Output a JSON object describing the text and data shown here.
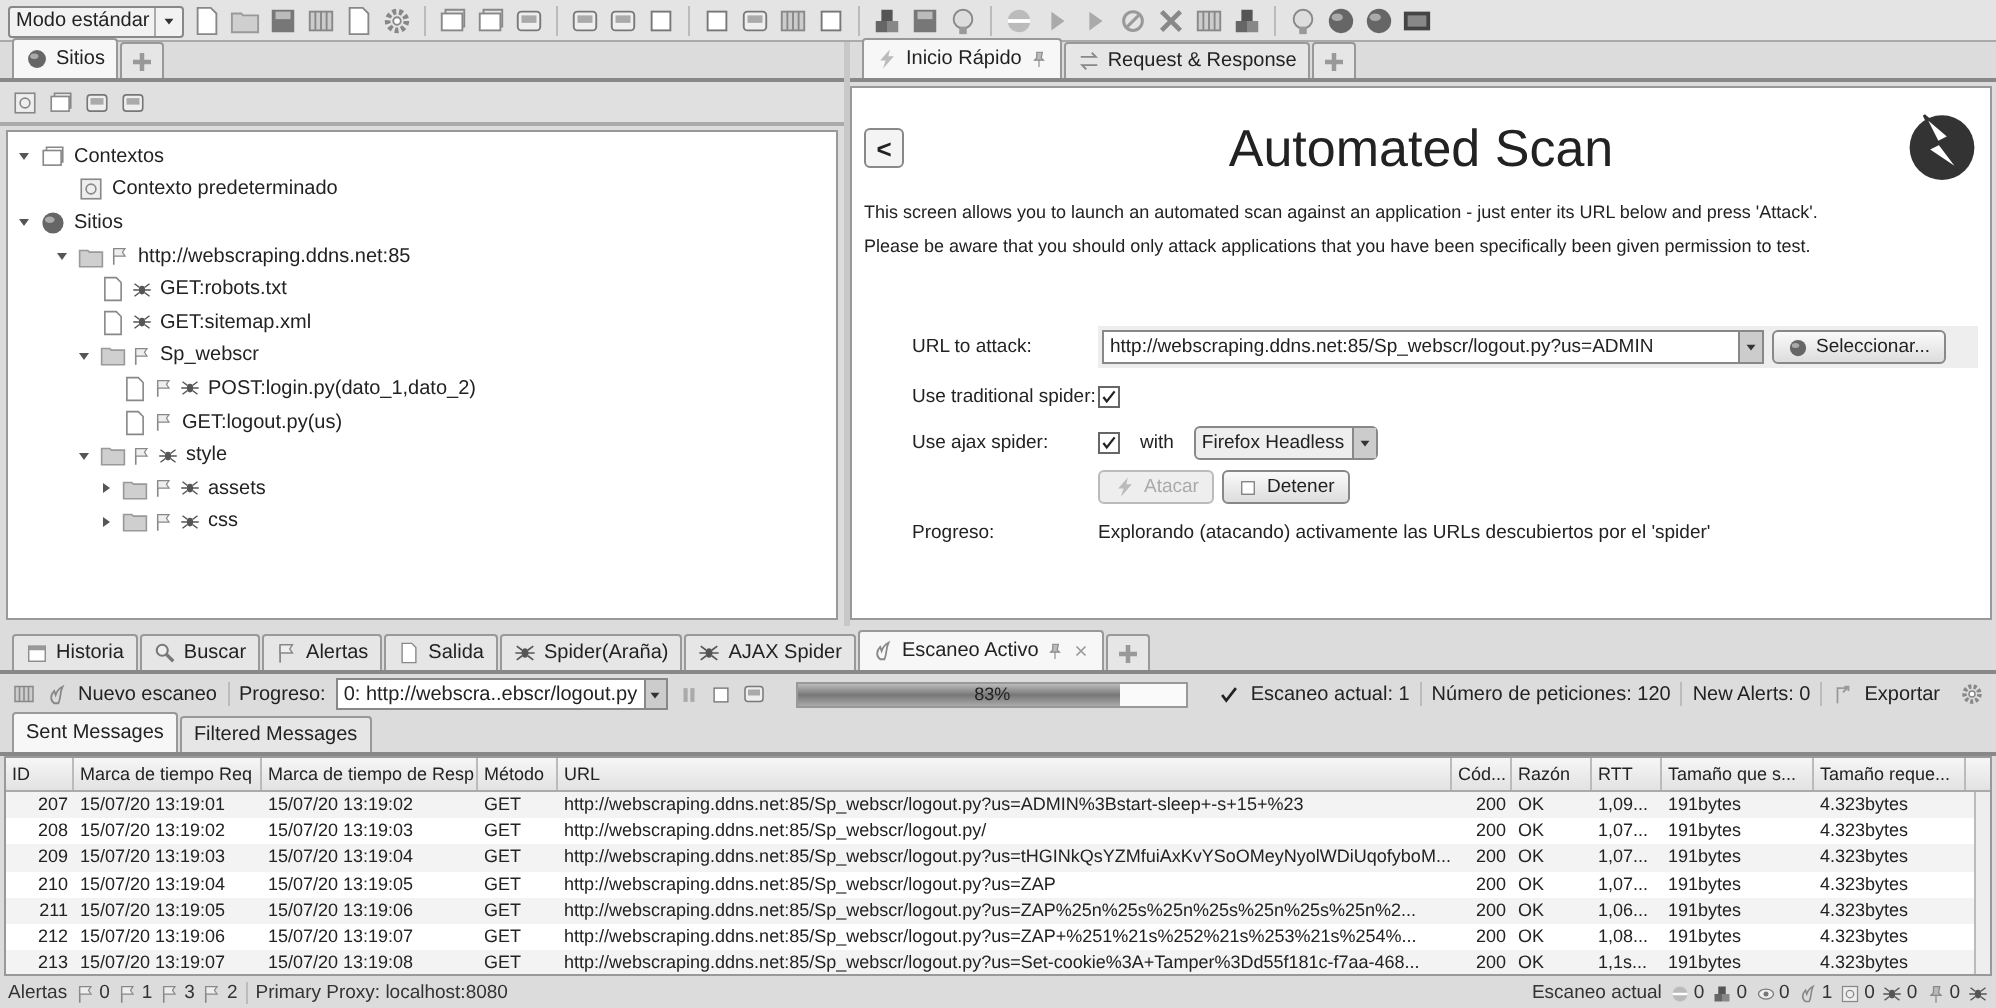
{
  "toolbar": {
    "mode": "Modo estándar"
  },
  "sites_panel": {
    "tabs": [
      {
        "label": "Sitios",
        "selected": true
      }
    ],
    "tree": [
      {
        "label": "Contextos",
        "kind": "contexts",
        "expanded": true,
        "flag": false,
        "spider": false,
        "children": [
          {
            "label": "Contexto predeterminado",
            "kind": "context",
            "flag": false,
            "spider": false
          }
        ]
      },
      {
        "label": "Sitios",
        "kind": "sites",
        "expanded": true,
        "flag": false,
        "spider": false,
        "children": [
          {
            "label": "http://webscraping.ddns.net:85",
            "kind": "folder",
            "expanded": true,
            "flag": true,
            "spider": false,
            "children": [
              {
                "label": "GET:robots.txt",
                "kind": "page",
                "flag": false,
                "spider": true
              },
              {
                "label": "GET:sitemap.xml",
                "kind": "page",
                "flag": false,
                "spider": true
              },
              {
                "label": "Sp_webscr",
                "kind": "folder",
                "expanded": true,
                "flag": true,
                "spider": false,
                "children": [
                  {
                    "label": "POST:login.py(dato_1,dato_2)",
                    "kind": "page",
                    "flag": true,
                    "spider": true
                  },
                  {
                    "label": "GET:logout.py(us)",
                    "kind": "page",
                    "flag": true,
                    "spider": false
                  }
                ]
              },
              {
                "label": "style",
                "kind": "folder",
                "expanded": true,
                "flag": true,
                "spider": true,
                "children": [
                  {
                    "label": "assets",
                    "kind": "folder",
                    "expanded": false,
                    "flag": true,
                    "spider": true
                  },
                  {
                    "label": "css",
                    "kind": "folder",
                    "expanded": false,
                    "flag": true,
                    "spider": true
                  }
                ]
              }
            ]
          }
        ]
      }
    ]
  },
  "work_panel": {
    "tabs": [
      {
        "label": "Inicio Rápido",
        "selected": true,
        "kind": "quickstart",
        "pinned": true
      },
      {
        "label": "Request & Response",
        "selected": false,
        "kind": "reqres",
        "pinned": false
      }
    ],
    "quick_start": {
      "back_button": "<",
      "title": "Automated Scan",
      "intro": [
        "This screen allows you to launch an automated scan against  an application - just enter its URL below and press 'Attack'.",
        "Please be aware that you should only attack applications that you have been specifically been given permission to test."
      ],
      "url_label": "URL to attack:",
      "url": "http://webscraping.ddns.net:85/Sp_webscr/logout.py?us=ADMIN",
      "select_button": "Seleccionar...",
      "traditional_spider": {
        "label": "Use traditional spider:",
        "checked": true
      },
      "ajax_spider": {
        "label": "Use ajax spider:",
        "checked": true,
        "with_label": "with",
        "browser": "Firefox Headless"
      },
      "buttons": [
        {
          "label": "Atacar",
          "kind": "attack",
          "disabled": true
        },
        {
          "label": "Detener",
          "kind": "stop",
          "disabled": false
        }
      ],
      "progress_label": "Progreso:",
      "progress_text": "Explorando (atacando) activamente las URLs descubiertos por el 'spider'"
    }
  },
  "bottom_panel": {
    "tabs": [
      {
        "label": "Historia",
        "kind": "history",
        "selected": false,
        "closable": false
      },
      {
        "label": "Buscar",
        "kind": "search",
        "selected": false,
        "closable": false
      },
      {
        "label": "Alertas",
        "kind": "alerts",
        "selected": false,
        "closable": false
      },
      {
        "label": "Salida",
        "kind": "output",
        "selected": false,
        "closable": false
      },
      {
        "label": "Spider(Araña)",
        "kind": "spider",
        "selected": false,
        "closable": false
      },
      {
        "label": "AJAX Spider",
        "kind": "spider",
        "selected": false,
        "closable": false
      },
      {
        "label": "Escaneo Activo",
        "kind": "scan",
        "selected": true,
        "closable": true
      }
    ],
    "scan_toolbar": {
      "new_scan": "Nuevo escaneo",
      "progress_label": "Progreso:",
      "scan_select": "0: http://webscra..ebscr/logout.py",
      "level": 0.83,
      "percent": "83%",
      "current_scan": "Escaneo actual: 1",
      "requests": "Número de peticiones: 120",
      "new_alerts": "New Alerts: 0",
      "export": "Exportar"
    },
    "message_tabs": [
      {
        "label": "Sent Messages",
        "selected": true
      },
      {
        "label": "Filtered Messages",
        "selected": false
      }
    ],
    "table": {
      "columns": [
        "ID",
        "Marca de tiempo Req",
        "Marca de tiempo de Resp",
        "Método",
        "URL",
        "Cód...",
        "Razón",
        "RTT",
        "Tamaño que s...",
        "Tamaño reque..."
      ],
      "rows": [
        [
          "207",
          "15/07/20 13:19:01",
          "15/07/20 13:19:02",
          "GET",
          "http://webscraping.ddns.net:85/Sp_webscr/logout.py?us=ADMIN%3Bstart-sleep+-s+15+%23",
          "200",
          "OK",
          "1,09...",
          "191bytes",
          "4.323bytes"
        ],
        [
          "208",
          "15/07/20 13:19:02",
          "15/07/20 13:19:03",
          "GET",
          "http://webscraping.ddns.net:85/Sp_webscr/logout.py/",
          "200",
          "OK",
          "1,07...",
          "191bytes",
          "4.323bytes"
        ],
        [
          "209",
          "15/07/20 13:19:03",
          "15/07/20 13:19:04",
          "GET",
          "http://webscraping.ddns.net:85/Sp_webscr/logout.py?us=tHGINkQsYZMfuiAxKvYSoOMeyNyolWDiUqofyboM...",
          "200",
          "OK",
          "1,07...",
          "191bytes",
          "4.323bytes"
        ],
        [
          "210",
          "15/07/20 13:19:04",
          "15/07/20 13:19:05",
          "GET",
          "http://webscraping.ddns.net:85/Sp_webscr/logout.py?us=ZAP",
          "200",
          "OK",
          "1,07...",
          "191bytes",
          "4.323bytes"
        ],
        [
          "211",
          "15/07/20 13:19:05",
          "15/07/20 13:19:06",
          "GET",
          "http://webscraping.ddns.net:85/Sp_webscr/logout.py?us=ZAP%25n%25s%25n%25s%25n%25s%25n%2...",
          "200",
          "OK",
          "1,06...",
          "191bytes",
          "4.323bytes"
        ],
        [
          "212",
          "15/07/20 13:19:06",
          "15/07/20 13:19:07",
          "GET",
          "http://webscraping.ddns.net:85/Sp_webscr/logout.py?us=ZAP+%251%21s%252%21s%253%21s%254%...",
          "200",
          "OK",
          "1,08...",
          "191bytes",
          "4.323bytes"
        ],
        [
          "213",
          "15/07/20 13:19:07",
          "15/07/20 13:19:08",
          "GET",
          "http://webscraping.ddns.net:85/Sp_webscr/logout.py?us=Set-cookie%3A+Tamper%3Dd55f181c-f7aa-468...",
          "200",
          "OK",
          "1,1s...",
          "191bytes",
          "4.323bytes"
        ]
      ]
    }
  },
  "status_bar": {
    "alerts_label": "Alertas",
    "alert_counts": [
      "0",
      "1",
      "3",
      "2"
    ],
    "proxy": "Primary Proxy: localhost:8080",
    "scan_label": "Escaneo actual",
    "scan_counts": [
      "0",
      "0",
      "0",
      "1",
      "0",
      "0",
      "0"
    ]
  }
}
